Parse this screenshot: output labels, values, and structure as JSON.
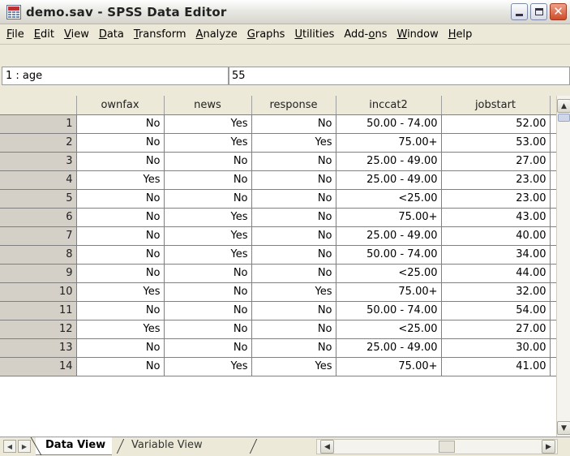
{
  "window": {
    "title": "demo.sav - SPSS Data Editor",
    "app_icon": "spss-grid-icon",
    "controls": [
      "minimize-icon",
      "maximize-icon",
      "close-icon"
    ]
  },
  "menu": [
    {
      "label": "File",
      "key": "F"
    },
    {
      "label": "Edit",
      "key": "E"
    },
    {
      "label": "View",
      "key": "V"
    },
    {
      "label": "Data",
      "key": "D"
    },
    {
      "label": "Transform",
      "key": "T"
    },
    {
      "label": "Analyze",
      "key": "A"
    },
    {
      "label": "Graphs",
      "key": "G"
    },
    {
      "label": "Utilities",
      "key": "U"
    },
    {
      "label": "Add-ons",
      "key": "o"
    },
    {
      "label": "Window",
      "key": "W"
    },
    {
      "label": "Help",
      "key": "H"
    }
  ],
  "cell_editor": {
    "reference": "1 : age",
    "value": "55"
  },
  "grid": {
    "columns": [
      "ownfax",
      "news",
      "response",
      "inccat2",
      "jobstart"
    ],
    "rows": [
      {
        "n": "1",
        "cells": [
          "No",
          "Yes",
          "No",
          "50.00 - 74.00",
          "52.00"
        ]
      },
      {
        "n": "2",
        "cells": [
          "No",
          "Yes",
          "Yes",
          "75.00+",
          "53.00"
        ]
      },
      {
        "n": "3",
        "cells": [
          "No",
          "No",
          "No",
          "25.00 - 49.00",
          "27.00"
        ]
      },
      {
        "n": "4",
        "cells": [
          "Yes",
          "No",
          "No",
          "25.00 - 49.00",
          "23.00"
        ]
      },
      {
        "n": "5",
        "cells": [
          "No",
          "No",
          "No",
          "<25.00",
          "23.00"
        ]
      },
      {
        "n": "6",
        "cells": [
          "No",
          "Yes",
          "No",
          "75.00+",
          "43.00"
        ]
      },
      {
        "n": "7",
        "cells": [
          "No",
          "Yes",
          "No",
          "25.00 - 49.00",
          "40.00"
        ]
      },
      {
        "n": "8",
        "cells": [
          "No",
          "Yes",
          "No",
          "50.00 - 74.00",
          "34.00"
        ]
      },
      {
        "n": "9",
        "cells": [
          "No",
          "No",
          "No",
          "<25.00",
          "44.00"
        ]
      },
      {
        "n": "10",
        "cells": [
          "Yes",
          "No",
          "Yes",
          "75.00+",
          "32.00"
        ]
      },
      {
        "n": "11",
        "cells": [
          "No",
          "No",
          "No",
          "50.00 - 74.00",
          "54.00"
        ]
      },
      {
        "n": "12",
        "cells": [
          "Yes",
          "No",
          "No",
          "<25.00",
          "27.00"
        ]
      },
      {
        "n": "13",
        "cells": [
          "No",
          "No",
          "No",
          "25.00 - 49.00",
          "30.00"
        ]
      },
      {
        "n": "14",
        "cells": [
          "No",
          "Yes",
          "Yes",
          "75.00+",
          "41.00"
        ]
      }
    ]
  },
  "tabs": {
    "data_view": "Data View",
    "variable_view": "Variable View"
  }
}
